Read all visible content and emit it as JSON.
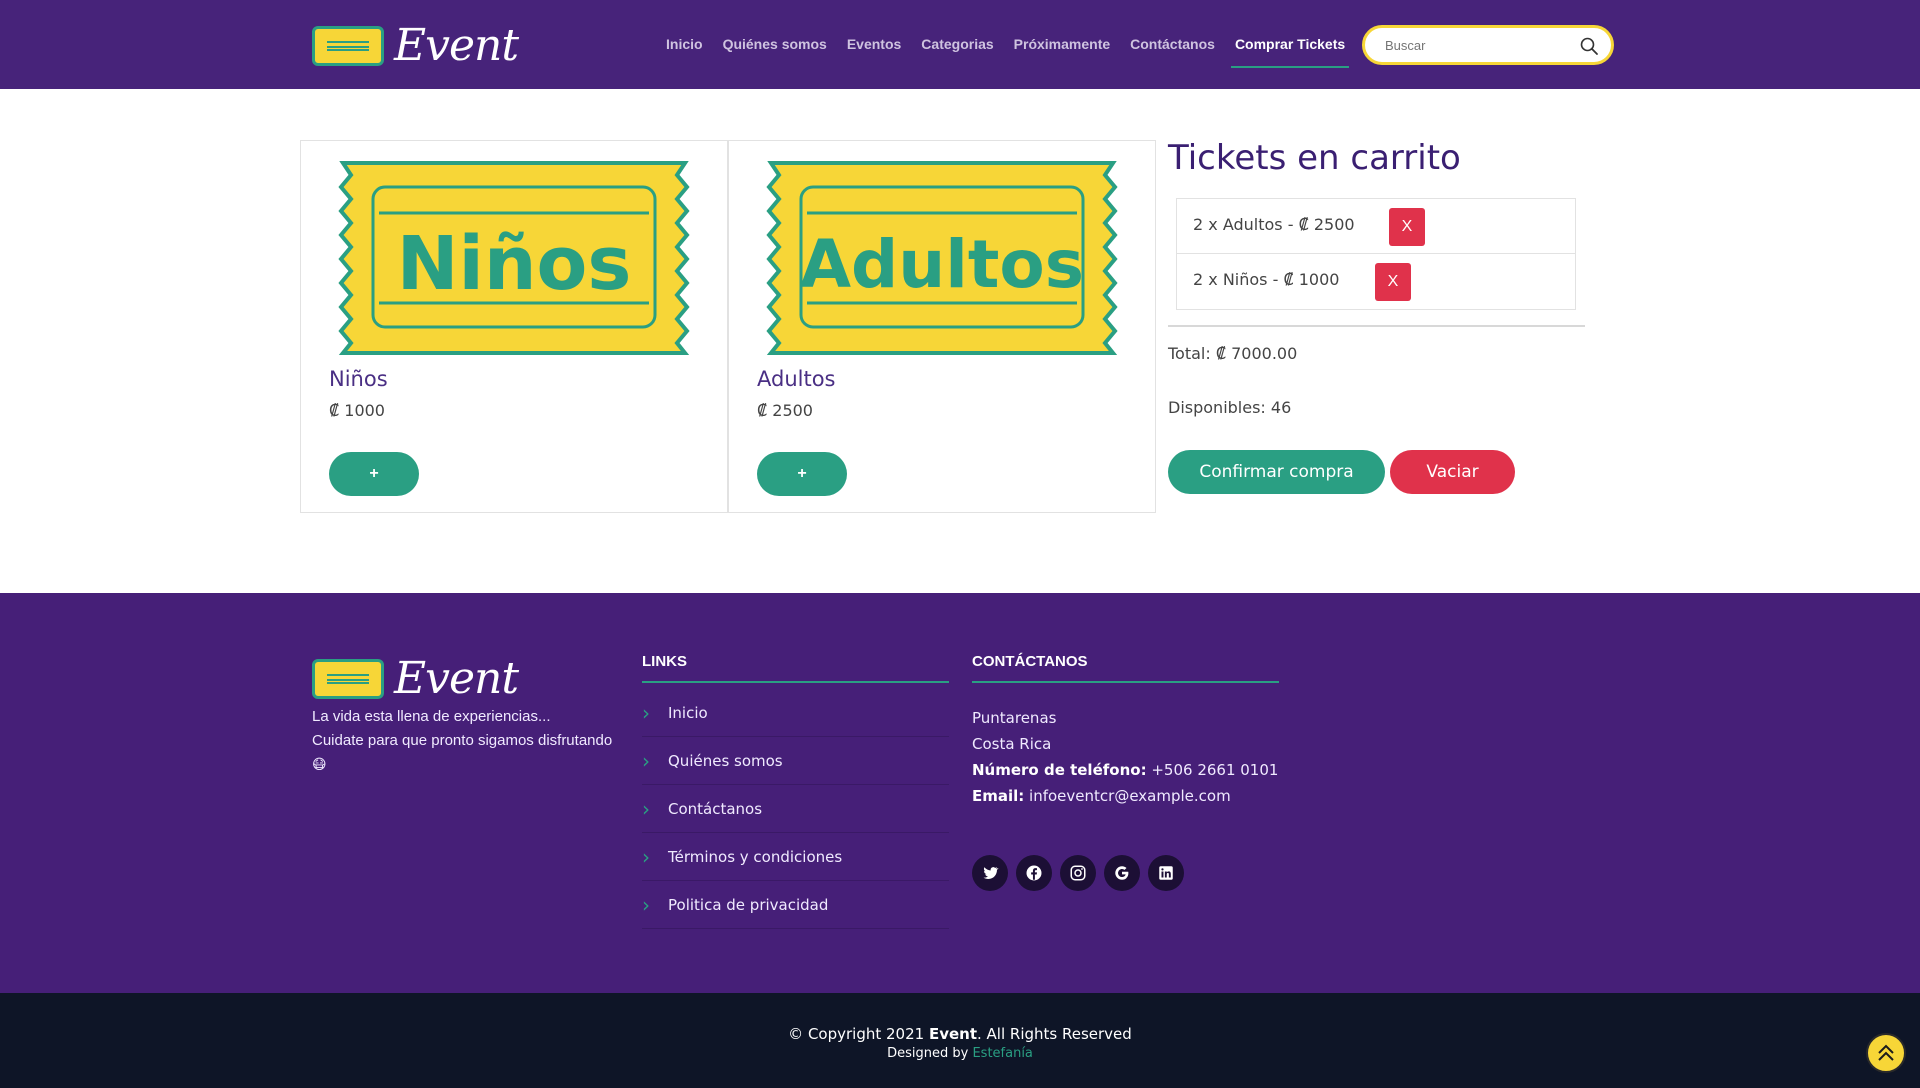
{
  "brand": {
    "name": "Event"
  },
  "nav": {
    "items": [
      "Inicio",
      "Quiénes somos",
      "Eventos",
      "Categorias",
      "Próximamente",
      "Contáctanos",
      "Comprar Tickets"
    ],
    "active_index": 6
  },
  "search": {
    "placeholder": "Buscar"
  },
  "products": [
    {
      "ticket_word": "Niños",
      "name": "Niños",
      "price": "₡ 1000",
      "add_label": "+"
    },
    {
      "ticket_word": "Adultos",
      "name": "Adultos",
      "price": "₡ 2500",
      "add_label": "+"
    }
  ],
  "cart": {
    "title": "Tickets en carrito",
    "items": [
      {
        "text": "2 x Adultos - ₡ 2500",
        "remove_label": "X"
      },
      {
        "text": "2 x Niños - ₡ 1000",
        "remove_label": "X"
      }
    ],
    "total": "Total: ₡ 7000.00",
    "available": "Disponibles: 46",
    "confirm_label": "Confirmar compra",
    "empty_label": "Vaciar"
  },
  "footer": {
    "tagline_line1": "La vida esta llena de experiencias...",
    "tagline_line2": "Cuidate para que pronto sigamos disfrutando",
    "tagline_emoji": "😷",
    "links_heading": "LINKS",
    "links": [
      "Inicio",
      "Quiénes somos",
      "Contáctanos",
      "Términos y condiciones",
      "Politica de privacidad"
    ],
    "contact_heading": "CONTÁCTANOS",
    "contact": {
      "city": "Puntarenas",
      "country": "Costa Rica",
      "phone_label": "Número de teléfono:",
      "phone": " +506 2661 0101",
      "email_label": "Email:",
      "email": " infoeventcr@example.com"
    },
    "socials": [
      "twitter-icon",
      "facebook-icon",
      "instagram-icon",
      "google-icon",
      "linkedin-icon"
    ]
  },
  "bottom": {
    "copyright_prefix": "© Copyright 2021 ",
    "copyright_brand": "Event",
    "copyright_suffix": ". All Rights Reserved",
    "designed_prefix": "Designed by ",
    "designed_author": "Estefanía"
  },
  "colors": {
    "header_bg": "#47237a",
    "accent_green": "#2a9f83",
    "accent_yellow": "#f7d637",
    "danger_red": "#e0324b",
    "footer_bg": "#461f78",
    "bottom_bg": "#0e1527"
  }
}
